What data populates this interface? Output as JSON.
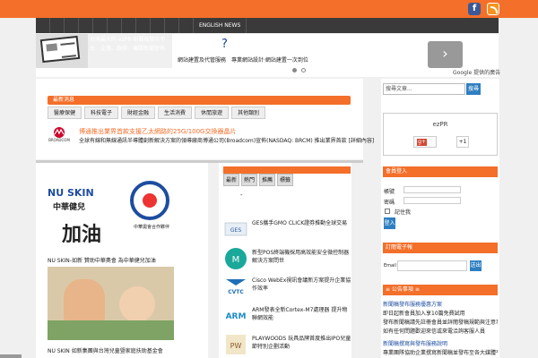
{
  "header": {
    "nav_items": [
      "ENGLISH NEWS"
    ],
    "tagline": "台灣最大的 ezPR 新聞稿發布平台　企業、政府、機關新聞發布",
    "brand": "ezPR"
  },
  "ad": {
    "question": "?",
    "text": "網站建置及代管服務　專業網站設計‧網站建置一次到位",
    "next": "›",
    "provider": "Google 提供的廣告"
  },
  "featured": {
    "section_title": "最新消息",
    "tags": [
      "醫療保健",
      "科技電子",
      "財經金融",
      "生活消費",
      "休閒旅遊",
      "其他類別"
    ],
    "news_title": "博通推出業界首款支援乙太網路的25G/100G交換器晶片",
    "news_desc": "全球有線和無線通訊半導體創新解決方案的領導廠商博通公司(Broadcom)宣佈(NASDAQ: BRCM) 推出業界首款 [詳細內容]",
    "news_logo": "BROADCOM"
  },
  "left_col": {
    "img1_brand": "NU SKIN",
    "img1_line1": "中華健兒",
    "img1_line2": "加油",
    "img1_emblem_text": "中華奧會合作夥伴",
    "caption1": "NU SKIN-如新 贊助中華奧會 為中華健兒加油",
    "caption2": "NU SKIN 如新集團與台灣兒童暨家庭扶助基金會"
  },
  "mid_col": {
    "tabs": [
      "最新",
      "熱門",
      "推薦",
      "標籤"
    ],
    "dash": "-",
    "items": [
      {
        "logo": "GES",
        "title": "GES攜手GMO CLICK證券推動全球交易"
      },
      {
        "logo": "M",
        "title": "新型POS終端機採用高效能安全微控制器解決方案問世"
      },
      {
        "logo": "CVTC",
        "title": "Cisco WebEx視訊會議新方案提升企業協作效率"
      },
      {
        "logo": "ARM",
        "title": "ARM發表全新Cortex-M7處理器 提升物聯網效能"
      },
      {
        "logo": "PW",
        "title": "PLAYWOODS 玩具品牌首度推出IPO兒童節特別企劃活動"
      }
    ]
  },
  "sidebar": {
    "search_placeholder": "搜尋文章...",
    "search_button": "搜尋",
    "gplus_name": "ezPR",
    "gplus_g": "g+",
    "gplus_count": "+1",
    "login_title": "會員登入",
    "user_label": "帳號",
    "pass_label": "密碼",
    "remember_label": "記住我",
    "login_button": "登入",
    "subscribe_title": "訂閱電子報",
    "email_label": "Email",
    "email_button": "送出",
    "notice_title": "≡ 公告事項 ≡",
    "notice_link1": "新聞稿發布服務優惠方案",
    "notice_text1": "即日起新會員加入享10篇免費試用",
    "notice_text2": "發布新聞稿請先註冊會員並詳閱發稿規範與注意事項內容",
    "notice_text3": "如有任何問題歡迎來信或來電洽詢客服人員",
    "notice_link2": "新聞稿撰寫與發布服務說明",
    "notice_text4": "專業團隊協助企業撰寫新聞稿並發布至各大媒體平台"
  },
  "colors": {
    "accent": "#f36f2a",
    "nav": "#3a3a3a",
    "link": "#1d4da0",
    "button": "#2e7fc1"
  }
}
